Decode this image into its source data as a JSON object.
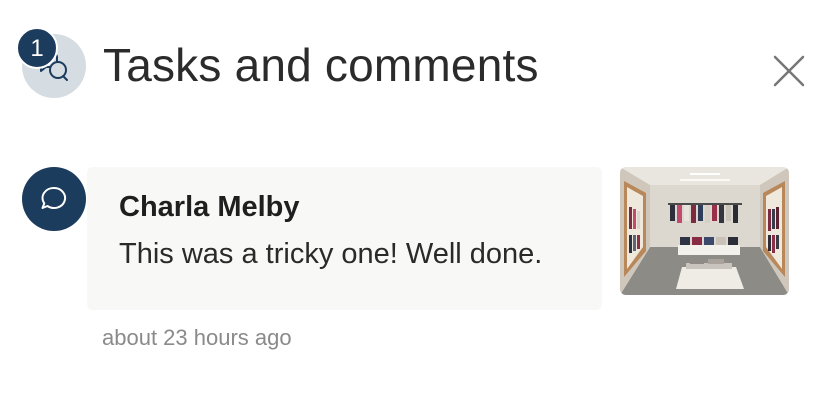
{
  "header": {
    "title": "Tasks and comments",
    "badge_count": "1",
    "icon": "comment-bubbles-icon",
    "close_icon": "close-icon"
  },
  "comments": [
    {
      "author": "Charla Melby",
      "text": "This was a tricky one! Well done.",
      "time": "about 23 hours ago",
      "avatar_icon": "comment-bubble-icon",
      "attachment": "store-photo-thumbnail"
    }
  ],
  "colors": {
    "navy": "#1c3c5e",
    "header_icon_bg": "#d5dce2",
    "card_bg": "#f8f8f7",
    "muted_text": "#8a8a8a"
  }
}
